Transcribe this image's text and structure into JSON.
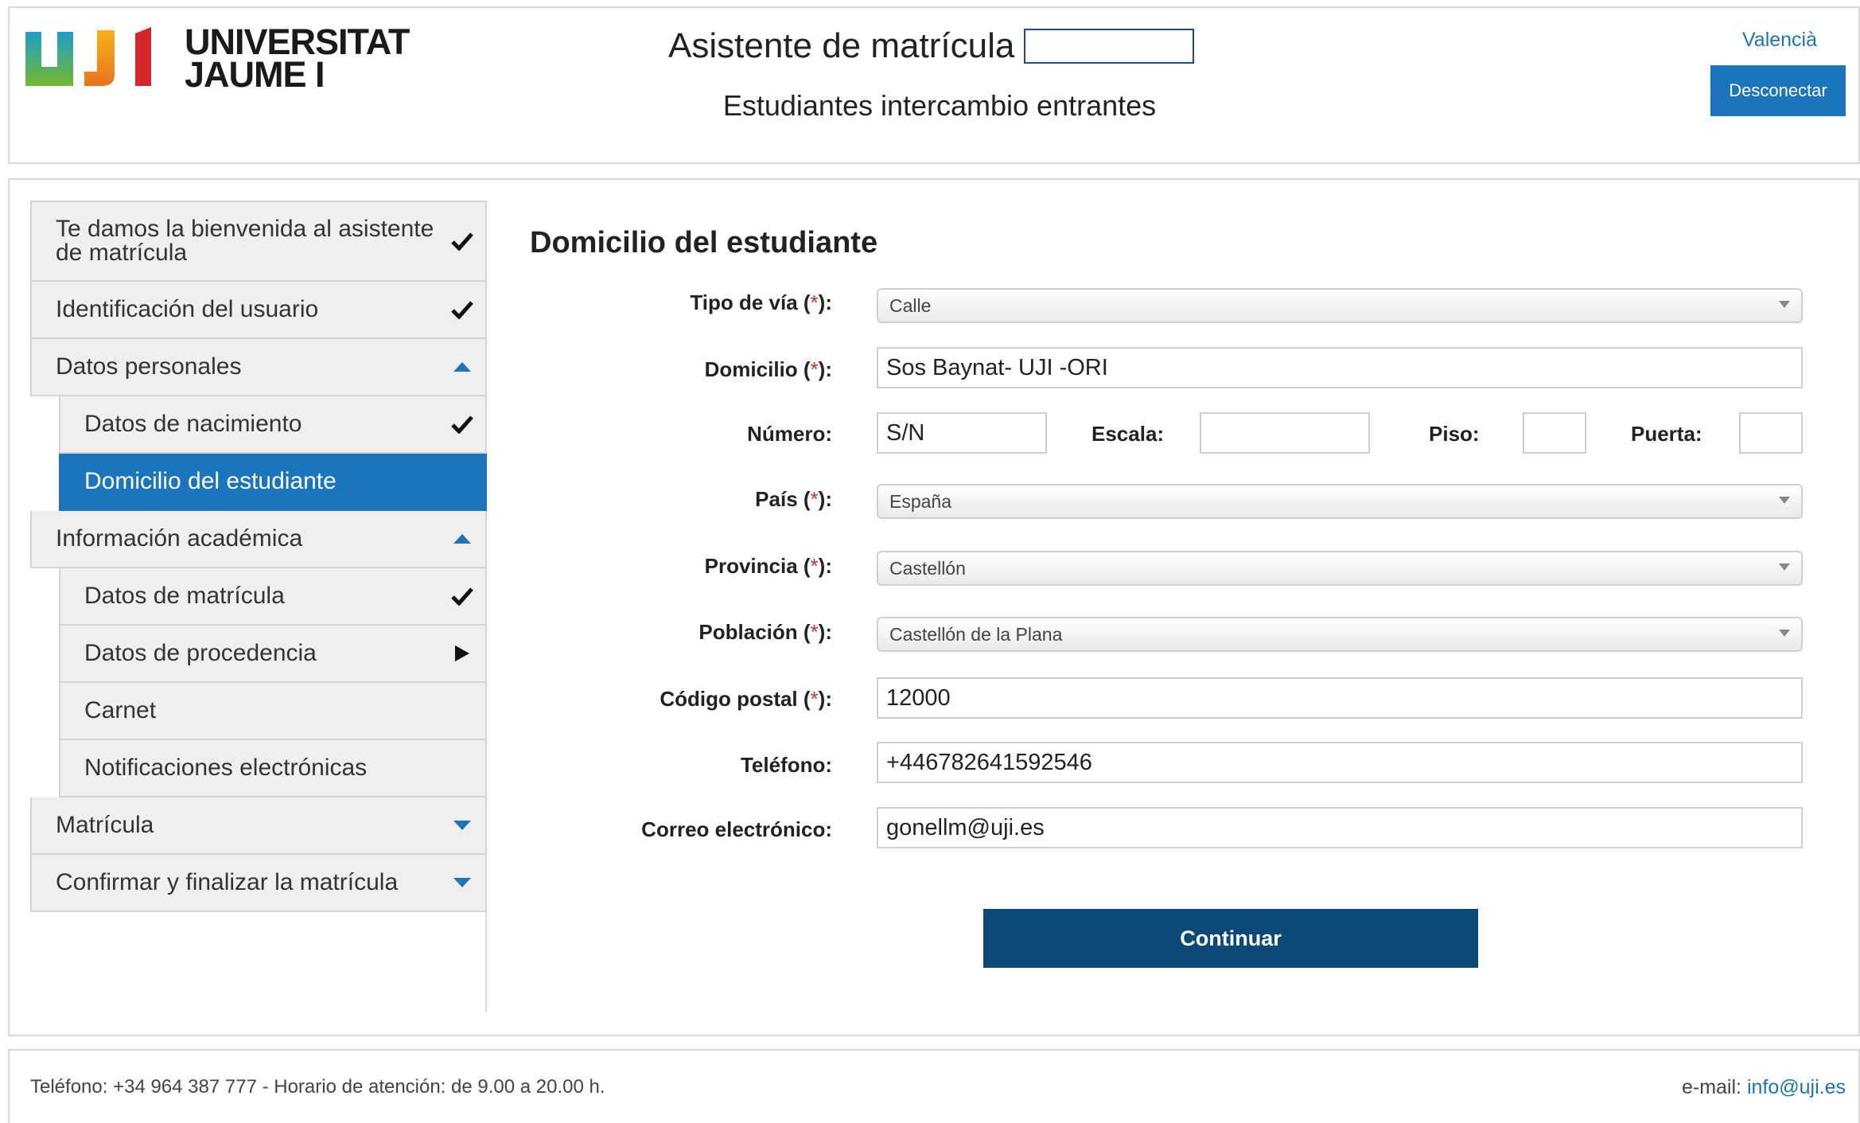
{
  "header": {
    "logo_text_line1": "UNIVERSITAT",
    "logo_text_line2": "JAUME I",
    "title": "Asistente de matrícula",
    "subtitle": "Estudiantes intercambio entrantes",
    "language_link": "Valencià",
    "logout_label": "Desconectar"
  },
  "sidebar": {
    "items": [
      {
        "label": "Te damos la bienvenida al asistente de matrícula",
        "icon": "check-icon"
      },
      {
        "label": "Identificación del usuario",
        "icon": "check-icon"
      },
      {
        "label": "Datos personales",
        "icon": "caret-up-icon"
      },
      {
        "label": "Datos de nacimiento",
        "icon": "check-icon"
      },
      {
        "label": "Domicilio del estudiante",
        "icon": "",
        "active": true
      },
      {
        "label": "Información académica",
        "icon": "caret-up-icon"
      },
      {
        "label": "Datos de matrícula",
        "icon": "check-icon"
      },
      {
        "label": "Datos de procedencia",
        "icon": "play-icon"
      },
      {
        "label": "Carnet",
        "icon": ""
      },
      {
        "label": "Notificaciones electrónicas",
        "icon": ""
      },
      {
        "label": "Matrícula",
        "icon": "caret-down-icon"
      },
      {
        "label": "Confirmar y finalizar la matrícula",
        "icon": "caret-down-icon"
      }
    ]
  },
  "form": {
    "title": "Domicilio del estudiante",
    "required_mark": "*",
    "tipo_via": {
      "label_pre": "Tipo de vía (",
      "label_post": "):",
      "value": "Calle"
    },
    "domicilio": {
      "label_pre": "Domicilio (",
      "label_post": "):",
      "value": "Sos Baynat- UJI -ORI"
    },
    "numero": {
      "label": "Número:",
      "value": "S/N"
    },
    "escala": {
      "label": "Escala:",
      "value": ""
    },
    "piso": {
      "label": "Piso:",
      "value": ""
    },
    "puerta": {
      "label": "Puerta:",
      "value": ""
    },
    "pais": {
      "label_pre": "País (",
      "label_post": "):",
      "value": "España"
    },
    "provincia": {
      "label_pre": "Provincia (",
      "label_post": "):",
      "value": "Castellón"
    },
    "poblacion": {
      "label_pre": "Población (",
      "label_post": "):",
      "value": "Castellón de la Plana"
    },
    "codigo_postal": {
      "label_pre": "Código postal (",
      "label_post": "):",
      "value": "12000"
    },
    "telefono": {
      "label": "Teléfono:",
      "value": "+446782641592546"
    },
    "correo": {
      "label": "Correo electrónico:",
      "value": "gonellm@uji.es"
    },
    "continue_label": "Continuar"
  },
  "footer": {
    "contact_text": "Teléfono: +34 964 387 777 - Horario de atención: de 9.00 a 20.00 h.",
    "email_label": "e-mail: ",
    "email_link": "info@uji.es"
  },
  "colors": {
    "accent": "#1b75bc",
    "button_dark": "#0b4a76",
    "required": "#c0392b"
  }
}
